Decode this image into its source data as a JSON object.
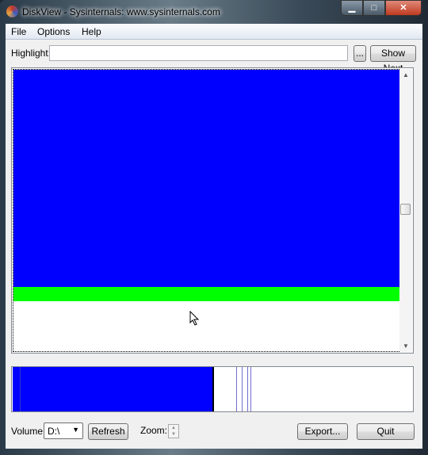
{
  "window": {
    "title": "DiskView - Sysinternals: www.sysinternals.com",
    "minimize": "▁",
    "maximize": "□",
    "close": "✕"
  },
  "menu": [
    "File",
    "Options",
    "Help"
  ],
  "highlight": {
    "label": "Highlight:",
    "value": "",
    "browse_label": "...",
    "show_next_label": "Show Next"
  },
  "map": {
    "colors": {
      "used": "#0000ff",
      "other": "#00ff00",
      "free": "#ffffff"
    }
  },
  "bottom": {
    "volume_label": "Volume:",
    "volume_value": "D:\\",
    "refresh_label": "Refresh",
    "zoom_label": "Zoom:",
    "export_label": "Export...",
    "quit_label": "Quit"
  }
}
